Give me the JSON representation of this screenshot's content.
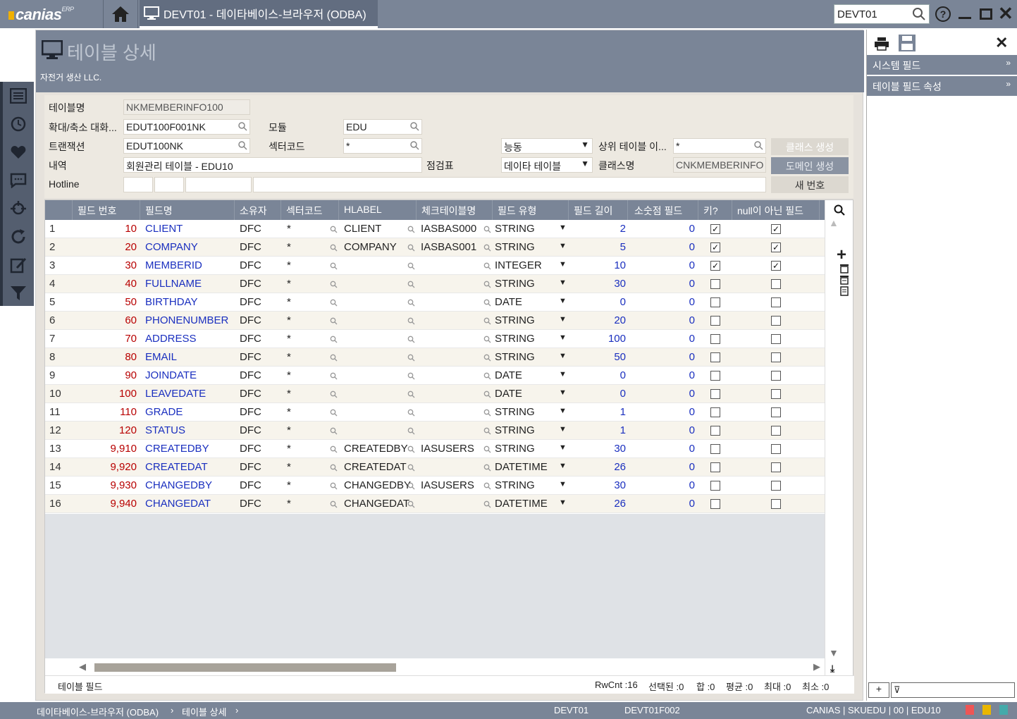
{
  "app": {
    "logo": "canias",
    "logo_sup": "ERP",
    "tab_title": "DEVT01 - 데이타베이스-브라우저 (ODBA)",
    "search_value": "DEVT01"
  },
  "page": {
    "title": "테이블 상세",
    "company": "자전거 생산 LLC."
  },
  "form": {
    "table_name_label": "테이블명",
    "table_name": "NKMEMBERINFO100",
    "ext_label": "확대/축소 대화...",
    "ext_value": "EDUT100F001NK",
    "module_label": "모듈",
    "module_value": "EDU",
    "trans_label": "트랜잭션",
    "trans_value": "EDUT100NK",
    "sector_label": "섹터코드",
    "sector_value": "*",
    "mode_value": "능동",
    "parent_label": "상위 테이블 이...",
    "parent_value": "*",
    "class_create": "클래스 생성",
    "desc_label": "내역",
    "desc_value": "회원관리 테이블 - EDU10",
    "checklist_label": "점검표",
    "checklist_value": "데이타 테이블",
    "classname_label": "클래스명",
    "classname_value": "CNKMEMBERINFO",
    "domain_create": "도메인 생성",
    "hotline_label": "Hotline",
    "new_number": "새 번호"
  },
  "grid": {
    "columns": [
      "필드 번호",
      "필드명",
      "소유자",
      "섹터코드",
      "HLABEL",
      "체크테이블명",
      "필드 유형",
      "필드 길이",
      "소숫점 필드",
      "키?",
      "null이 아닌 필드"
    ],
    "rows": [
      {
        "n": "1",
        "no": "10",
        "name": "CLIENT",
        "owner": "DFC",
        "sector": "*",
        "hlabel": "CLIENT",
        "check": "IASBAS000",
        "type": "STRING",
        "len": "2",
        "dec": "0",
        "key": true,
        "nn": true
      },
      {
        "n": "2",
        "no": "20",
        "name": "COMPANY",
        "owner": "DFC",
        "sector": "*",
        "hlabel": "COMPANY",
        "check": "IASBAS001",
        "type": "STRING",
        "len": "5",
        "dec": "0",
        "key": true,
        "nn": true
      },
      {
        "n": "3",
        "no": "30",
        "name": "MEMBERID",
        "owner": "DFC",
        "sector": "*",
        "hlabel": "",
        "check": "",
        "type": "INTEGER",
        "len": "10",
        "dec": "0",
        "key": true,
        "nn": true
      },
      {
        "n": "4",
        "no": "40",
        "name": "FULLNAME",
        "owner": "DFC",
        "sector": "*",
        "hlabel": "",
        "check": "",
        "type": "STRING",
        "len": "30",
        "dec": "0",
        "key": false,
        "nn": false
      },
      {
        "n": "5",
        "no": "50",
        "name": "BIRTHDAY",
        "owner": "DFC",
        "sector": "*",
        "hlabel": "",
        "check": "",
        "type": "DATE",
        "len": "0",
        "dec": "0",
        "key": false,
        "nn": false
      },
      {
        "n": "6",
        "no": "60",
        "name": "PHONENUMBER",
        "owner": "DFC",
        "sector": "*",
        "hlabel": "",
        "check": "",
        "type": "STRING",
        "len": "20",
        "dec": "0",
        "key": false,
        "nn": false
      },
      {
        "n": "7",
        "no": "70",
        "name": "ADDRESS",
        "owner": "DFC",
        "sector": "*",
        "hlabel": "",
        "check": "",
        "type": "STRING",
        "len": "100",
        "dec": "0",
        "key": false,
        "nn": false
      },
      {
        "n": "8",
        "no": "80",
        "name": "EMAIL",
        "owner": "DFC",
        "sector": "*",
        "hlabel": "",
        "check": "",
        "type": "STRING",
        "len": "50",
        "dec": "0",
        "key": false,
        "nn": false
      },
      {
        "n": "9",
        "no": "90",
        "name": "JOINDATE",
        "owner": "DFC",
        "sector": "*",
        "hlabel": "",
        "check": "",
        "type": "DATE",
        "len": "0",
        "dec": "0",
        "key": false,
        "nn": false
      },
      {
        "n": "10",
        "no": "100",
        "name": "LEAVEDATE",
        "owner": "DFC",
        "sector": "*",
        "hlabel": "",
        "check": "",
        "type": "DATE",
        "len": "0",
        "dec": "0",
        "key": false,
        "nn": false
      },
      {
        "n": "11",
        "no": "110",
        "name": "GRADE",
        "owner": "DFC",
        "sector": "*",
        "hlabel": "",
        "check": "",
        "type": "STRING",
        "len": "1",
        "dec": "0",
        "key": false,
        "nn": false
      },
      {
        "n": "12",
        "no": "120",
        "name": "STATUS",
        "owner": "DFC",
        "sector": "*",
        "hlabel": "",
        "check": "",
        "type": "STRING",
        "len": "1",
        "dec": "0",
        "key": false,
        "nn": false
      },
      {
        "n": "13",
        "no": "9,910",
        "name": "CREATEDBY",
        "owner": "DFC",
        "sector": "*",
        "hlabel": "CREATEDBY",
        "check": "IASUSERS",
        "type": "STRING",
        "len": "30",
        "dec": "0",
        "key": false,
        "nn": false
      },
      {
        "n": "14",
        "no": "9,920",
        "name": "CREATEDAT",
        "owner": "DFC",
        "sector": "*",
        "hlabel": "CREATEDAT",
        "check": "",
        "type": "DATETIME",
        "len": "26",
        "dec": "0",
        "key": false,
        "nn": false
      },
      {
        "n": "15",
        "no": "9,930",
        "name": "CHANGEDBY",
        "owner": "DFC",
        "sector": "*",
        "hlabel": "CHANGEDBY",
        "check": "IASUSERS",
        "type": "STRING",
        "len": "30",
        "dec": "0",
        "key": false,
        "nn": false
      },
      {
        "n": "16",
        "no": "9,940",
        "name": "CHANGEDAT",
        "owner": "DFC",
        "sector": "*",
        "hlabel": "CHANGEDAT",
        "check": "",
        "type": "DATETIME",
        "len": "26",
        "dec": "0",
        "key": false,
        "nn": false
      }
    ],
    "footer_tab": "테이블 필드",
    "stats": {
      "rwcnt": "RwCnt :16",
      "selected": "선택된 :0",
      "sum": "합 :0",
      "avg": "평균 :0",
      "max": "최대 :0",
      "min": "최소 :0"
    }
  },
  "right_panel": {
    "sections": [
      "시스템 필드",
      "테이블 필드 속성"
    ]
  },
  "status": {
    "breadcrumb1": "데이타베이스-브라우저 (ODBA)",
    "breadcrumb2": "테이블 상세",
    "client": "DEVT01",
    "trans": "DEVT01F002",
    "info": "CANIAS | SKUEDU | 00 | EDU10"
  }
}
